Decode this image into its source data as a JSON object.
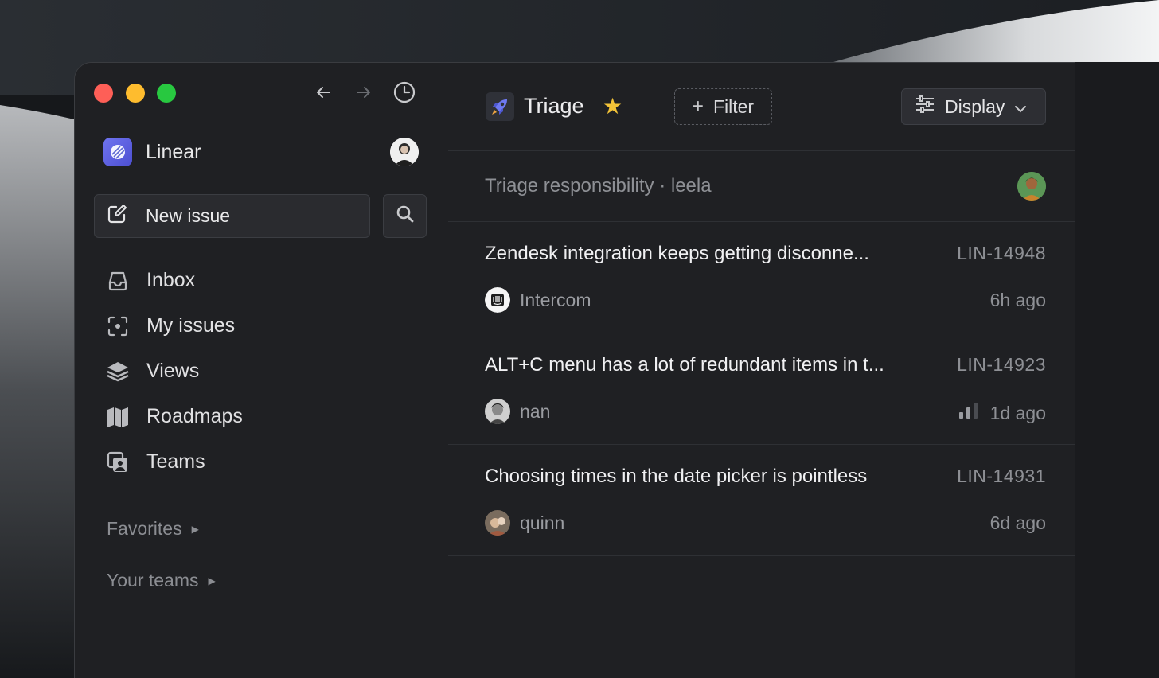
{
  "window": {
    "nav": {
      "back_icon": "arrow-left-icon",
      "forward_icon": "arrow-right-icon",
      "history_icon": "clock-icon"
    }
  },
  "sidebar": {
    "workspace_name": "Linear",
    "new_issue_label": "New issue",
    "items": [
      {
        "label": "Inbox",
        "icon": "inbox-icon"
      },
      {
        "label": "My issues",
        "icon": "my-issues-icon"
      },
      {
        "label": "Views",
        "icon": "layers-icon"
      },
      {
        "label": "Roadmaps",
        "icon": "map-icon"
      },
      {
        "label": "Teams",
        "icon": "teams-icon"
      }
    ],
    "favorites_label": "Favorites",
    "your_teams_label": "Your teams"
  },
  "header": {
    "title": "Triage",
    "filter_label": "Filter",
    "display_label": "Display"
  },
  "triage": {
    "responsibility_text": "Triage responsibility · leela"
  },
  "issues": [
    {
      "title": "Zendesk integration keeps getting disconne...",
      "id": "LIN-14948",
      "source": "Intercom",
      "age": "6h ago"
    },
    {
      "title": "ALT+C menu has a lot of redundant items in t...",
      "id": "LIN-14923",
      "source": "nan",
      "age": "1d ago"
    },
    {
      "title": "Choosing times in the date picker is pointless",
      "id": "LIN-14931",
      "source": "quinn",
      "age": "6d ago"
    }
  ],
  "colors": {
    "accent": "#5e6ad2",
    "star": "#f3c338",
    "background": "#1f2023"
  }
}
